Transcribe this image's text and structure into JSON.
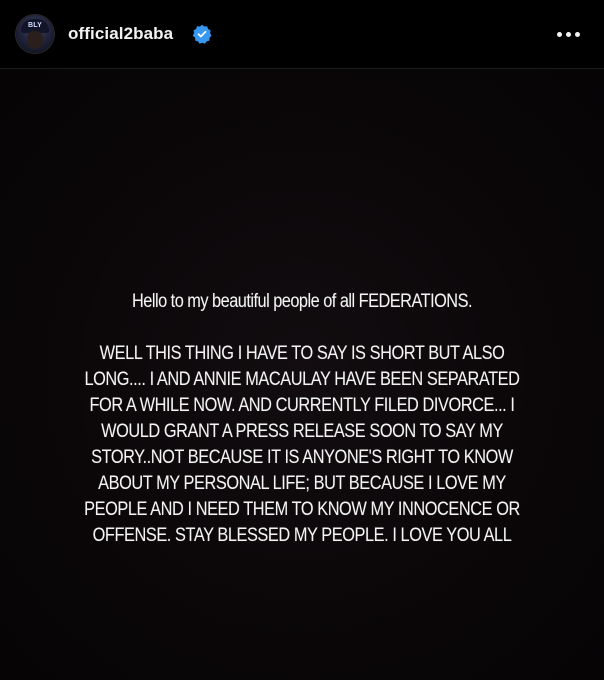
{
  "header": {
    "username": "official2baba",
    "verified": true,
    "avatar_cap_text": "BLY",
    "avatar_icon": "profile-avatar",
    "verified_icon": "verified-badge-icon",
    "more_icon": "more-options-icon",
    "verified_color": "#3897f0"
  },
  "story": {
    "background_color": "#0b0709",
    "greeting": "Hello to my beautiful people of all FEDERATIONS.",
    "message": "WELL THIS THING I HAVE TO SAY IS SHORT BUT ALSO LONG.... I AND ANNIE MACAULAY HAVE BEEN SEPARATED FOR A WHILE NOW. AND CURRENTLY FILED DIVORCE... I WOULD GRANT A PRESS RELEASE SOON TO SAY MY STORY..NOT BECAUSE IT IS ANYONE'S RIGHT TO KNOW ABOUT MY PERSONAL LIFE; BUT BECAUSE I LOVE MY PEOPLE AND I NEED THEM TO KNOW MY INNOCENCE OR OFFENSE. STAY BLESSED MY PEOPLE. I LOVE YOU ALL"
  }
}
